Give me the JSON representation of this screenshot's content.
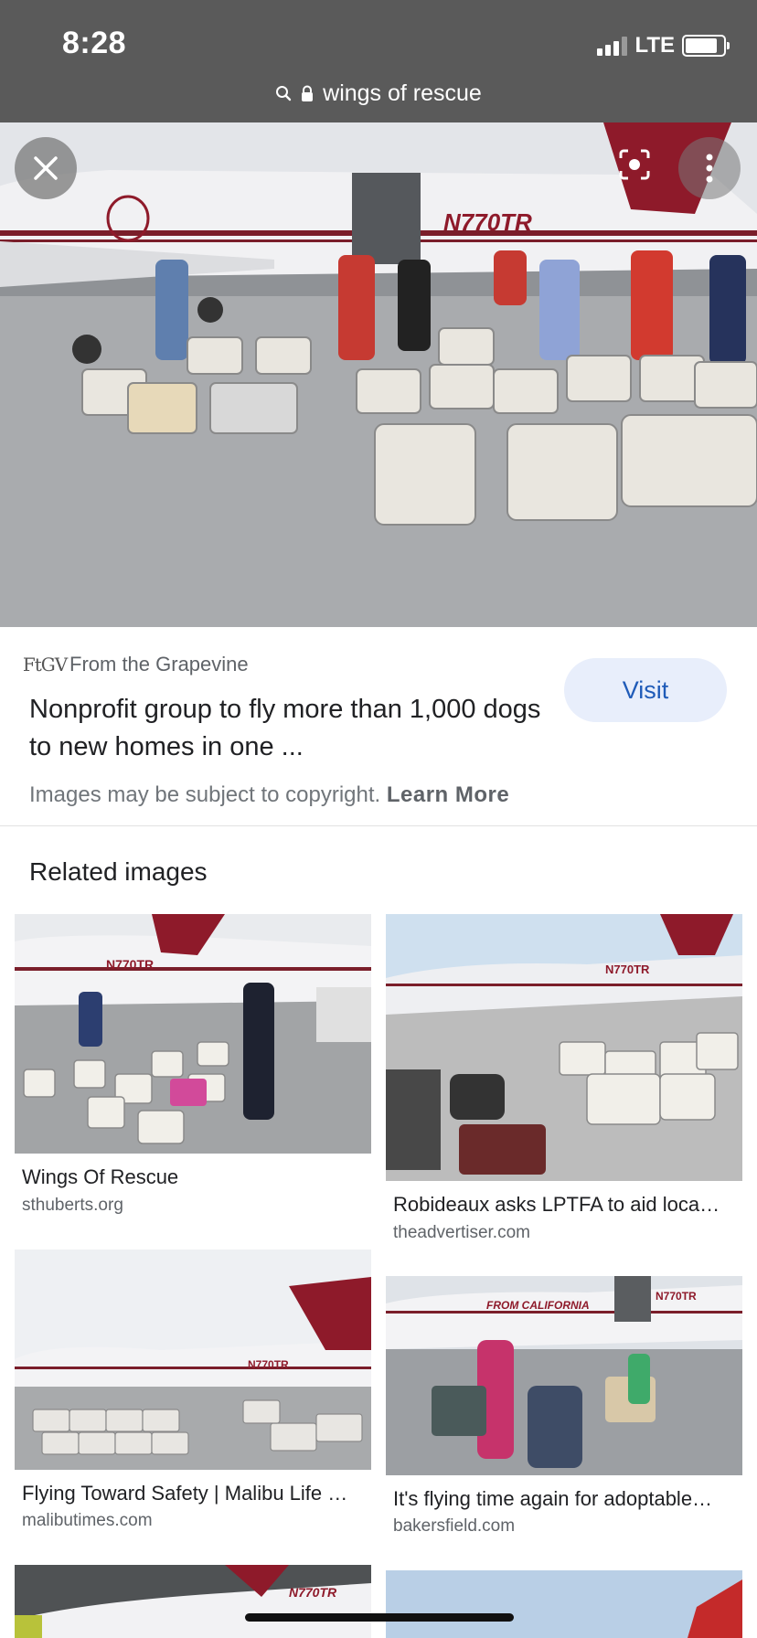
{
  "status_bar": {
    "time": "8:28",
    "network": "LTE"
  },
  "url_bar": {
    "text": "wings of rescue",
    "search_icon": "search-icon",
    "lock_icon": "lock-icon"
  },
  "hero": {
    "tail_registration": "N770TR",
    "close_icon": "close-icon",
    "lens_icon": "lens-icon",
    "more_icon": "more-vertical-icon"
  },
  "source": {
    "favicon_text": "FtGV",
    "name": "From the Grapevine",
    "title": "Nonprofit group to fly more than 1,000 dogs to new homes in one ...",
    "visit_label": "Visit",
    "copyright_text": "Images may be subject to copyright.",
    "learn_more_label": "Learn More"
  },
  "related": {
    "heading": "Related images",
    "items": [
      {
        "title": "Wings Of Rescue",
        "domain": "sthuberts.org",
        "reg": "N770TR"
      },
      {
        "title": "Robideaux asks LPTFA to aid loca…",
        "domain": "theadvertiser.com",
        "reg": "N770TR"
      },
      {
        "title": "Flying Toward Safety | Malibu Life …",
        "domain": "malibutimes.com",
        "reg": "N770TR"
      },
      {
        "title": "It's flying time again for adoptable…",
        "domain": "bakersfield.com",
        "reg": "N770TR",
        "fuselage_text": "FROM CALIFORNIA"
      },
      {
        "reg": "N770TR"
      }
    ]
  },
  "colors": {
    "accent": "#1f5bb8",
    "visit_bg": "#e8eefb",
    "plane_red": "#8e1a2a",
    "top_bar": "#5a5a5a"
  }
}
